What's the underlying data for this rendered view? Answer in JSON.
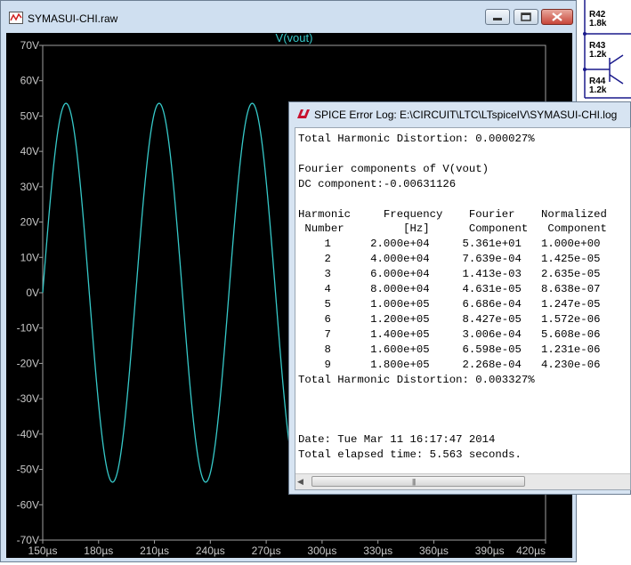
{
  "wave_window": {
    "title": "SYMASUI-CHI.raw",
    "trace_label": "V(vout)",
    "trace_color": "#36c9c9",
    "background": "#000000",
    "axis_color": "#a0a0a0",
    "label_color": "#c8c8c8",
    "y_ticks": [
      "70V",
      "60V",
      "50V",
      "40V",
      "30V",
      "20V",
      "10V",
      "0V",
      "-10V",
      "-20V",
      "-30V",
      "-40V",
      "-50V",
      "-60V",
      "-70V"
    ],
    "x_ticks": [
      "150µs",
      "180µs",
      "210µs",
      "240µs",
      "270µs",
      "300µs",
      "330µs",
      "360µs",
      "390µs",
      "420µs"
    ]
  },
  "chart_data": {
    "type": "line",
    "title": "V(vout)",
    "series": [
      {
        "name": "V(vout)",
        "amplitude": 53.61,
        "frequency_hz": 20000,
        "x_start_us": 150,
        "x_end_us": 284
      }
    ],
    "xlim": [
      150,
      420
    ],
    "ylim": [
      -70,
      70
    ],
    "x_unit": "µs",
    "y_unit": "V",
    "grid": false
  },
  "log_window": {
    "title": "SPICE Error Log: E:\\CIRCUIT\\LTC\\LTspiceIV\\SYMASUI-CHI.log",
    "lines": [
      "Total Harmonic Distortion: 0.000027%",
      "",
      "Fourier components of V(vout)",
      "DC component:-0.00631126",
      "",
      "Harmonic     Frequency    Fourier    Normalized",
      " Number         [Hz]      Component   Component",
      "    1      2.000e+04     5.361e+01   1.000e+00",
      "    2      4.000e+04     7.639e-04   1.425e-05",
      "    3      6.000e+04     1.413e-03   2.635e-05",
      "    4      8.000e+04     4.631e-05   8.638e-07",
      "    5      1.000e+05     6.686e-04   1.247e-05",
      "    6      1.200e+05     8.427e-05   1.572e-06",
      "    7      1.400e+05     3.006e-04   5.608e-06",
      "    8      1.600e+05     6.598e-05   1.231e-06",
      "    9      1.800e+05     2.268e-04   4.230e-06",
      "Total Harmonic Distortion: 0.003327%",
      "",
      "",
      "",
      "Date: Tue Mar 11 16:17:47 2014",
      "Total elapsed time: 5.563 seconds."
    ],
    "scroll_grip": "|||"
  },
  "schematic": {
    "resistors": [
      {
        "name": "R42",
        "value": "1.8k"
      },
      {
        "name": "R43",
        "value": "1.2k"
      },
      {
        "name": "R44",
        "value": "1.2k"
      }
    ]
  }
}
